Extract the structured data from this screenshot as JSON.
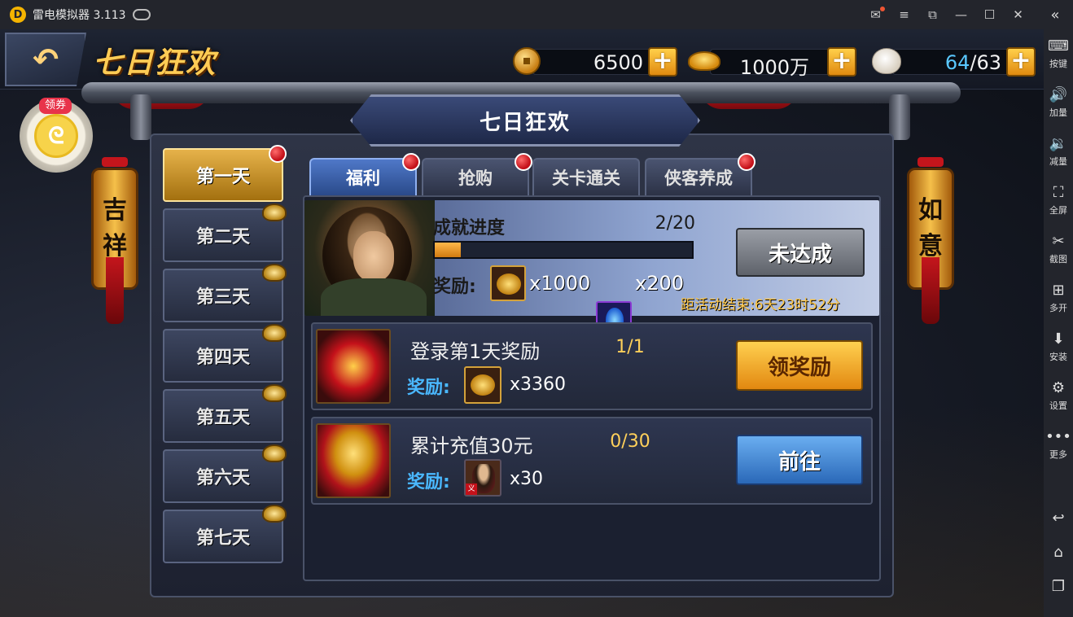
{
  "emulator": {
    "title": "雷电模拟器 3.113",
    "logo_char": "D",
    "controls": [
      "mail-icon",
      "menu-icon",
      "resize-icon",
      "minimize-icon",
      "maximize-icon",
      "close-icon"
    ],
    "collapse_icon": "double-chevron-left-icon"
  },
  "sidebar": {
    "items": [
      {
        "label": "按键",
        "icon": "keyboard-icon"
      },
      {
        "label": "加量",
        "icon": "volume-up-icon"
      },
      {
        "label": "减量",
        "icon": "volume-down-icon"
      },
      {
        "label": "全屏",
        "icon": "fullscreen-icon"
      },
      {
        "label": "截图",
        "icon": "scissors-icon"
      },
      {
        "label": "多开",
        "icon": "multi-open-icon"
      },
      {
        "label": "安装",
        "icon": "apk-install-icon"
      },
      {
        "label": "设置",
        "icon": "gear-icon"
      },
      {
        "label": "更多",
        "icon": "more-dots-icon"
      }
    ],
    "nav": [
      "back-icon",
      "home-icon",
      "recent-apps-icon"
    ]
  },
  "game": {
    "page_title": "七日狂欢",
    "resources": {
      "copper": "6500",
      "ingot": "1000万",
      "stamina_current": "64",
      "stamina_max": "/63"
    },
    "coupon_tag": "领券",
    "panel_title": "七日狂欢",
    "lanterns": {
      "left": [
        "吉",
        "祥"
      ],
      "right": [
        "如",
        "意"
      ]
    },
    "days": [
      {
        "label": "第一天",
        "active": true,
        "red_dot": true,
        "locked": false
      },
      {
        "label": "第二天",
        "active": false,
        "red_dot": false,
        "locked": true
      },
      {
        "label": "第三天",
        "active": false,
        "red_dot": false,
        "locked": true
      },
      {
        "label": "第四天",
        "active": false,
        "red_dot": false,
        "locked": true
      },
      {
        "label": "第五天",
        "active": false,
        "red_dot": false,
        "locked": true
      },
      {
        "label": "第六天",
        "active": false,
        "red_dot": false,
        "locked": true
      },
      {
        "label": "第七天",
        "active": false,
        "red_dot": false,
        "locked": true
      }
    ],
    "tabs": [
      {
        "label": "福利",
        "active": true,
        "red_dot": true
      },
      {
        "label": "抢购",
        "active": false,
        "red_dot": true
      },
      {
        "label": "关卡通关",
        "active": false,
        "red_dot": false
      },
      {
        "label": "侠客养成",
        "active": false,
        "red_dot": true
      }
    ],
    "achievement": {
      "title": "成就进度",
      "count": "2/20",
      "progress_fraction": 0.1,
      "reward_label": "奖励:",
      "rewards": [
        {
          "icon": "gold-pile-icon",
          "qty": "x1000"
        },
        {
          "icon": "spirit-orb-icon",
          "qty": "x200"
        }
      ],
      "button": "未达成",
      "timer": "距活动结束:6天23时52分"
    },
    "tasks": [
      {
        "name": "登录第1天奖励",
        "progress": "1/1",
        "reward_label": "奖励:",
        "reward_icon": "gold-pile-icon",
        "reward_qty": "x3360",
        "button": "领奖励",
        "button_style": "gold",
        "icon": "treasure-chest-icon"
      },
      {
        "name": "累计充值30元",
        "progress": "0/30",
        "reward_label": "奖励:",
        "reward_icon": "hero-portrait-icon",
        "reward_qty": "x30",
        "button": "前往",
        "button_style": "blue",
        "icon": "gold-chest-icon"
      }
    ],
    "portrait_tag": "义"
  }
}
